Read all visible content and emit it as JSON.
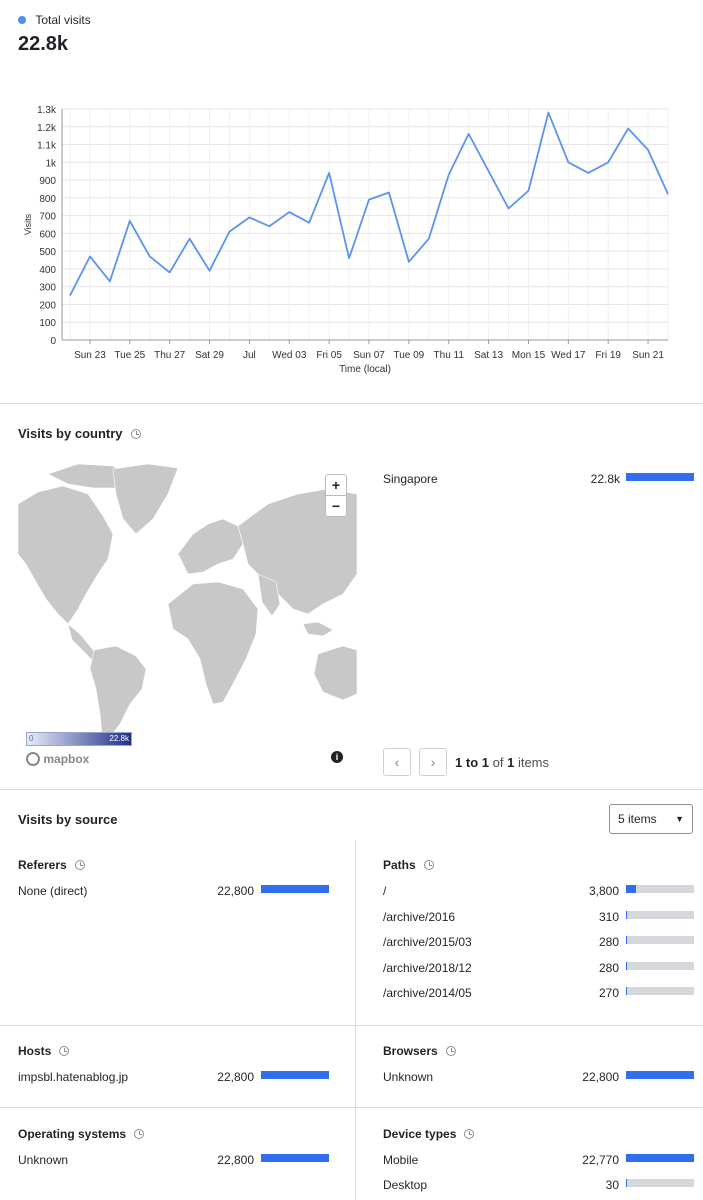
{
  "summary": {
    "legend_label": "Total visits",
    "total": "22.8k"
  },
  "chart_data": {
    "type": "line",
    "ylabel": "Visits",
    "xlabel": "Time (local)",
    "ylim": [
      0,
      1300
    ],
    "y_ticks": [
      "0",
      "100",
      "200",
      "300",
      "400",
      "500",
      "600",
      "700",
      "800",
      "900",
      "1k",
      "1.1k",
      "1.2k",
      "1.3k"
    ],
    "x_tick_labels": [
      "Sun 23",
      "Tue 25",
      "Thu 27",
      "Sat 29",
      "Jul",
      "Wed 03",
      "Fri 05",
      "Sun 07",
      "Tue 09",
      "Thu 11",
      "Sat 13",
      "Mon 15",
      "Wed 17",
      "Fri 19",
      "Sun 21"
    ],
    "grid": true,
    "series_color": "#5b93ee",
    "values": [
      250,
      470,
      330,
      670,
      470,
      380,
      570,
      390,
      610,
      690,
      640,
      720,
      660,
      940,
      460,
      790,
      830,
      440,
      570,
      930,
      1160,
      950,
      740,
      840,
      1280,
      1000,
      940,
      1000,
      1190,
      1070,
      820
    ]
  },
  "country": {
    "title": "Visits by country",
    "zoom_in": "+",
    "zoom_out": "−",
    "scale_min": "0",
    "scale_max": "22.8k",
    "map_brand": "mapbox",
    "info_icon": "i",
    "rows": [
      {
        "label": "Singapore",
        "value": "22.8k",
        "fraction": 1.0
      }
    ],
    "pager": {
      "from": "1",
      "to_word": "to",
      "to": "1",
      "of_word": "of",
      "count": "1",
      "items_word": "items"
    }
  },
  "source": {
    "title": "Visits by source",
    "items_select": "5 items",
    "referers": {
      "title": "Referers",
      "rows": [
        {
          "label": "None (direct)",
          "value": "22,800",
          "fraction": 1.0
        }
      ]
    },
    "paths": {
      "title": "Paths",
      "rows": [
        {
          "label": "/",
          "value": "3,800",
          "fraction": 0.15
        },
        {
          "label": "/archive/2016",
          "value": "310",
          "fraction": 0.02
        },
        {
          "label": "/archive/2015/03",
          "value": "280",
          "fraction": 0.015
        },
        {
          "label": "/archive/2018/12",
          "value": "280",
          "fraction": 0.015
        },
        {
          "label": "/archive/2014/05",
          "value": "270",
          "fraction": 0.015
        }
      ]
    },
    "hosts": {
      "title": "Hosts",
      "rows": [
        {
          "label": "impsbl.hatenablog.jp",
          "value": "22,800",
          "fraction": 1.0
        }
      ]
    },
    "browsers": {
      "title": "Browsers",
      "rows": [
        {
          "label": "Unknown",
          "value": "22,800",
          "fraction": 1.0
        }
      ]
    },
    "os": {
      "title": "Operating systems",
      "rows": [
        {
          "label": "Unknown",
          "value": "22,800",
          "fraction": 1.0
        }
      ]
    },
    "devices": {
      "title": "Device types",
      "rows": [
        {
          "label": "Mobile",
          "value": "22,770",
          "fraction": 1.0
        },
        {
          "label": "Desktop",
          "value": "30",
          "fraction": 0.01
        }
      ]
    }
  }
}
